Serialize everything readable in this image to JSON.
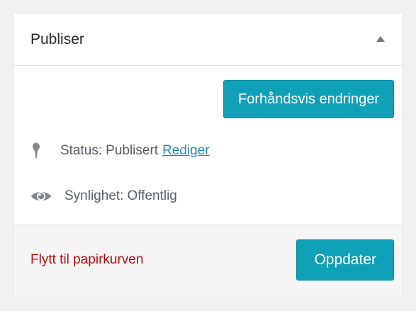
{
  "panel": {
    "title": "Publiser",
    "toggle_icon": "triangle-up-icon"
  },
  "actions": {
    "preview_label": "Forhåndsvis endringer",
    "update_label": "Oppdater",
    "trash_label": "Flytt til papirkurven"
  },
  "status": {
    "icon": "pin-icon",
    "prefix": "Status:",
    "value": "Publisert",
    "edit_label": "Rediger"
  },
  "visibility": {
    "icon": "eye-icon",
    "prefix": "Synlighet:",
    "value": "Offentlig"
  },
  "colors": {
    "primary_button": "#10a0b7",
    "link": "#1e8cbe",
    "danger": "#bc0b0b",
    "text": "#555d66"
  }
}
